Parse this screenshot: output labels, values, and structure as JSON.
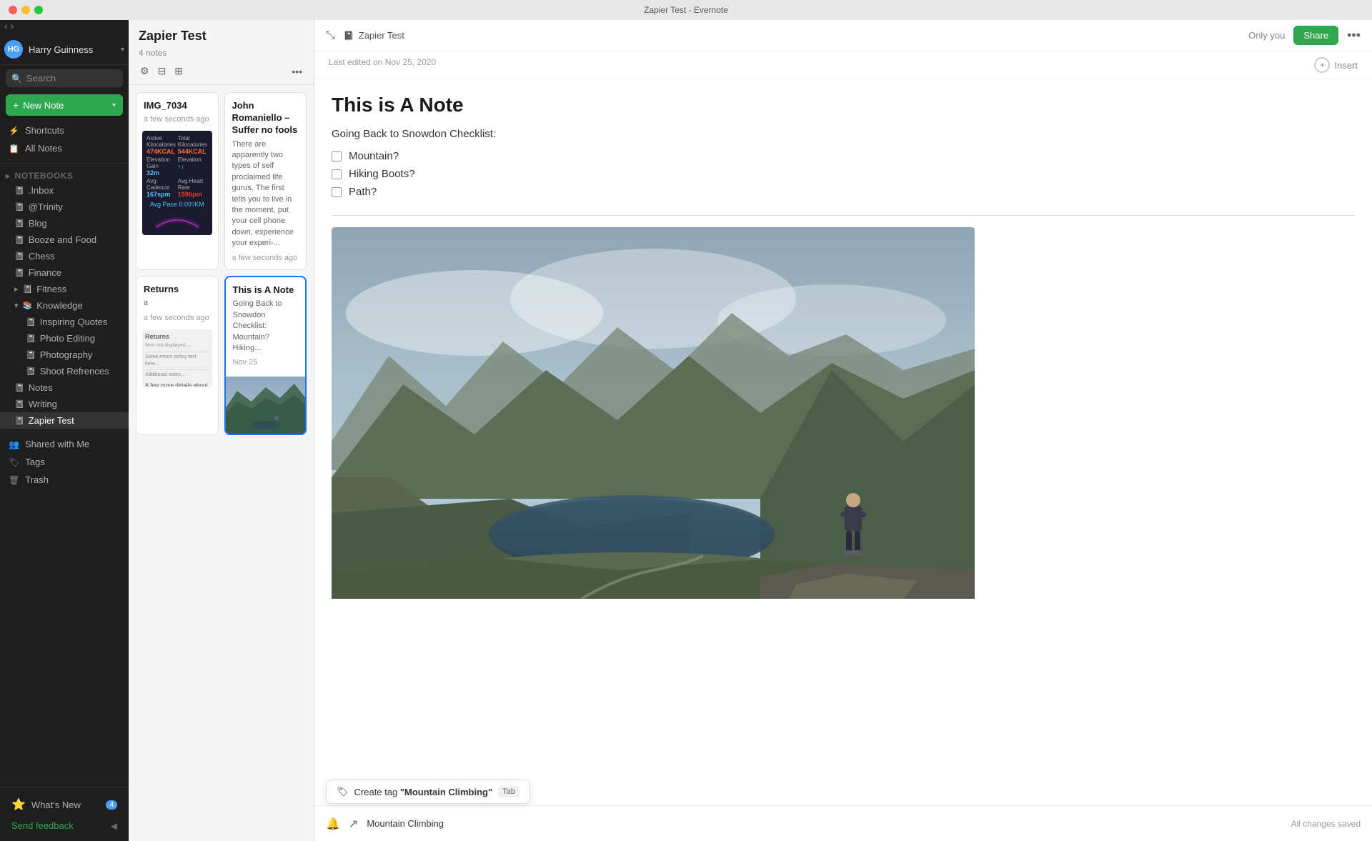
{
  "window": {
    "title": "Zapier Test - Evernote",
    "traffic_lights": [
      "close",
      "minimize",
      "maximize"
    ]
  },
  "sidebar": {
    "user": {
      "name": "Harry Guinness",
      "avatar_initials": "HG"
    },
    "search_placeholder": "Search",
    "new_note_label": "New Note",
    "nav_items": [
      {
        "id": "shortcuts",
        "label": "Shortcuts",
        "icon": "⚡"
      },
      {
        "id": "all-notes",
        "label": "All Notes",
        "icon": "📝"
      }
    ],
    "notebooks_section": "Notebooks",
    "notebooks": [
      {
        "id": "inbox",
        "label": ".Inbox",
        "level": 1
      },
      {
        "id": "trinity",
        "label": "@Trinity",
        "level": 1
      },
      {
        "id": "blog",
        "label": "Blog",
        "level": 1
      },
      {
        "id": "booze-food",
        "label": "Booze and Food",
        "level": 1
      },
      {
        "id": "chess",
        "label": "Chess",
        "level": 1
      },
      {
        "id": "finance",
        "label": "Finance",
        "level": 1
      },
      {
        "id": "fitness",
        "label": "Fitness",
        "level": 1,
        "has_children": true
      },
      {
        "id": "knowledge",
        "label": "Knowledge",
        "level": 1,
        "expanded": true
      },
      {
        "id": "inspiring-quotes",
        "label": "Inspiring Quotes",
        "level": 2
      },
      {
        "id": "photo-editing",
        "label": "Photo Editing",
        "level": 2
      },
      {
        "id": "photography",
        "label": "Photography",
        "level": 2
      },
      {
        "id": "shoot-references",
        "label": "Shoot Refrences",
        "level": 2
      },
      {
        "id": "notes",
        "label": "Notes",
        "level": 1
      },
      {
        "id": "writing",
        "label": "Writing",
        "level": 1
      },
      {
        "id": "zapier-test",
        "label": "Zapier Test",
        "level": 1,
        "active": true
      }
    ],
    "shared_with_me": "Shared with Me",
    "tags": "Tags",
    "trash": "Trash",
    "footer": {
      "whats_new": "What's New",
      "badge_count": "4",
      "feedback": "Send feedback"
    }
  },
  "notes_list": {
    "title": "Zapier Test",
    "count": "4 notes",
    "toolbar_icons": [
      "filter",
      "sort",
      "grid",
      "more"
    ],
    "notes": [
      {
        "id": "img-7034",
        "title": "IMG_7034",
        "time": "a few seconds ago",
        "has_fitness_thumb": true
      },
      {
        "id": "john-romaniello",
        "title": "John Romaniello – Suffer no fools",
        "preview": "There are apparently two types of self proclaimed life gurus. The first tells you to live in the moment, put your cell phone down, experience your experi-...",
        "time": "a few seconds ago"
      },
      {
        "id": "returns",
        "title": "Returns",
        "preview": "a",
        "time": "a few seconds ago",
        "has_doc_thumb": true
      },
      {
        "id": "this-is-a-note",
        "title": "This is A Note",
        "preview": "Going Back to Snowdon Checklist: Mountain? Hiking...",
        "date": "Nov 25",
        "has_mountain_thumb": true,
        "selected": true
      }
    ]
  },
  "editor": {
    "notebook_name": "Zapier Test",
    "only_you_label": "Only you",
    "share_label": "Share",
    "last_edited": "Last edited on Nov 25, 2020",
    "insert_label": "Insert",
    "note_title": "This is A Note",
    "checklist_header": "Going Back to Snowdon Checklist:",
    "checklist_items": [
      {
        "id": "mountain",
        "label": "Mountain?",
        "checked": false
      },
      {
        "id": "hiking-boots",
        "label": "Hiking Boots?",
        "checked": false
      },
      {
        "id": "path",
        "label": "Path?",
        "checked": false
      }
    ],
    "footer": {
      "tag_input_value": "Mountain Climbing",
      "tag_suggestion_label": "Create tag \"Mountain Climbing\"",
      "tab_key": "Tab",
      "all_changes_saved": "All changes saved"
    }
  }
}
